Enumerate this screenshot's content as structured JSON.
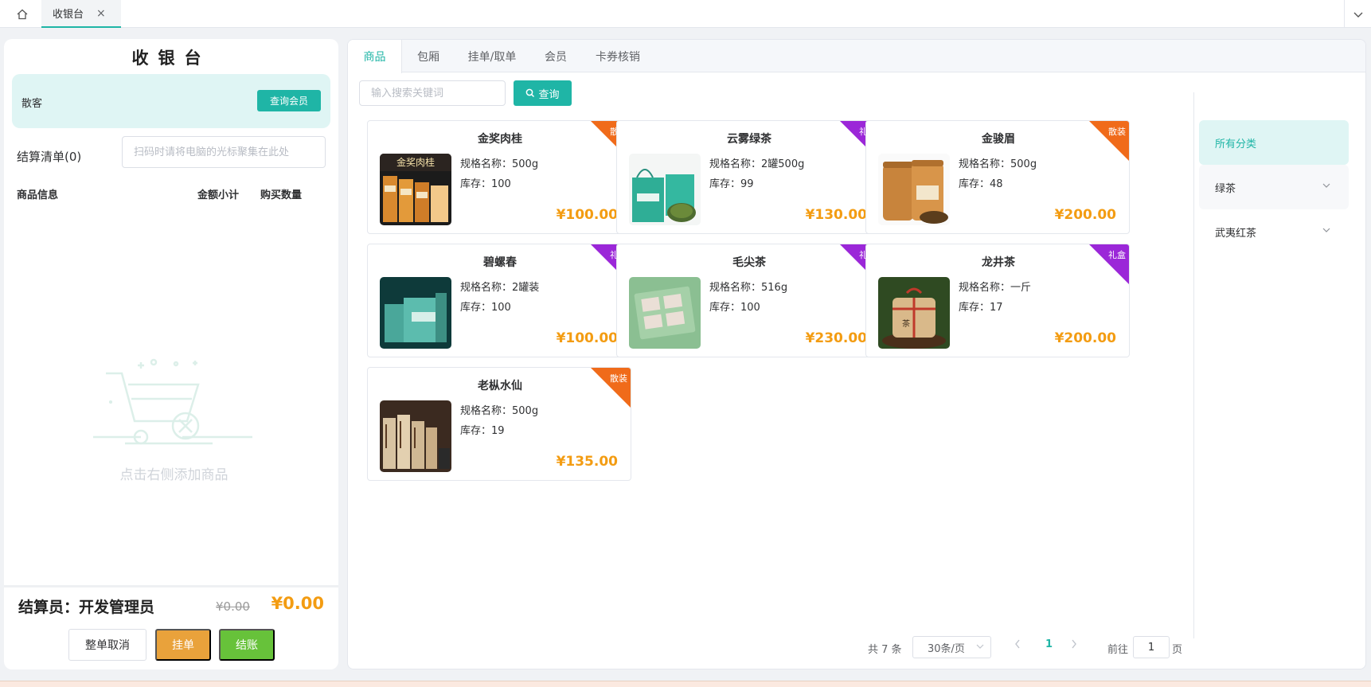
{
  "topbar": {
    "tab_label": "收银台",
    "close_glyph": "×"
  },
  "left": {
    "title": "收银台",
    "member_name": "散客",
    "query_member_label": "查询会员",
    "list_title": "结算清单(0)",
    "scan_placeholder": "扫码时请将电脑的光标聚集在此处",
    "col_product": "商品信息",
    "col_subtotal": "金额小计",
    "col_qty": "购买数量",
    "empty_text": "点击右侧添加商品",
    "cashier": "结算员：开发管理员",
    "original_total": "¥0.00",
    "final_total": "¥0.00",
    "btn_cancel": "整单取消",
    "btn_hold": "挂单",
    "btn_checkout": "结账"
  },
  "tabs": [
    "商品",
    "包厢",
    "挂单/取单",
    "会员",
    "卡券核销"
  ],
  "search": {
    "placeholder": "输入搜索关键词",
    "button": "查询"
  },
  "products": [
    {
      "name": "金奖肉桂",
      "spec": "规格名称：500g",
      "stock": "库存：100",
      "price": "¥100.00",
      "tag": "散装",
      "tag_type": "bulk",
      "img": "box-orange"
    },
    {
      "name": "云雾绿茶",
      "spec": "规格名称：2罐500g",
      "stock": "库存：99",
      "price": "¥130.00",
      "tag": "礼盒",
      "tag_type": "gift",
      "img": "green-can"
    },
    {
      "name": "金骏眉",
      "spec": "规格名称：500g",
      "stock": "库存：48",
      "price": "¥200.00",
      "tag": "散装",
      "tag_type": "bulk",
      "img": "golden-jar"
    },
    {
      "name": "碧螺春",
      "spec": "规格名称：2罐装",
      "stock": "库存：100",
      "price": "¥100.00",
      "tag": "礼盒",
      "tag_type": "gift",
      "img": "teal-box"
    },
    {
      "name": "毛尖茶",
      "spec": "规格名称：516g",
      "stock": "库存：100",
      "price": "¥230.00",
      "tag": "礼盒",
      "tag_type": "gift",
      "img": "green-giftbox"
    },
    {
      "name": "龙井茶",
      "spec": "规格名称：一斤",
      "stock": "库存：17",
      "price": "¥200.00",
      "tag": "礼盒",
      "tag_type": "gift",
      "img": "paper-pack"
    },
    {
      "name": "老枞水仙",
      "spec": "规格名称：500g",
      "stock": "库存：19",
      "price": "¥135.00",
      "tag": "散装",
      "tag_type": "bulk",
      "img": "brick-stack"
    }
  ],
  "categories": [
    {
      "label": "所有分类",
      "state": "active"
    },
    {
      "label": "绿茶",
      "state": "expandable"
    },
    {
      "label": "武夷红茶",
      "state": "expandable"
    }
  ],
  "pagination": {
    "total": "共 7 条",
    "page_size": "30条/页",
    "current": "1",
    "goto_prefix": "前往",
    "goto_value": "1",
    "goto_suffix": "页"
  },
  "colors": {
    "accent": "#1fb5a6",
    "price": "#f39c12",
    "bulk_tag": "#f06b1a",
    "gift_tag": "#9b27d8"
  }
}
